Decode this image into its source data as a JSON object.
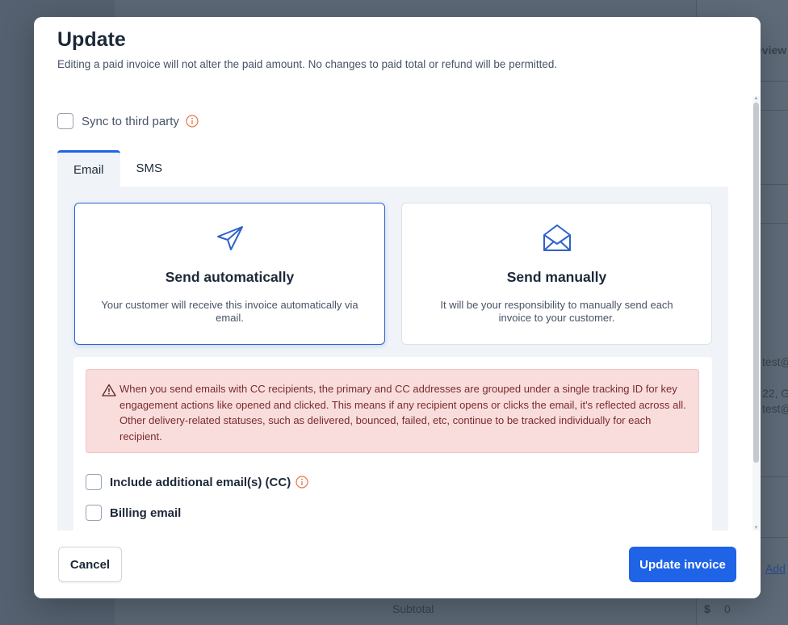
{
  "background": {
    "col_header": "eview",
    "email_partial_1": "test@",
    "address_partial": "22, G",
    "email_partial_2": "test@",
    "add_link": "Add",
    "subtotal_label": "Subtotal",
    "currency_symbol": "$",
    "subtotal_value": "0"
  },
  "modal": {
    "title": "Update",
    "subtitle": "Editing a paid invoice will not alter the paid amount. No changes to paid total or refund will be permitted.",
    "sync_label": "Sync to third party",
    "tabs": [
      {
        "label": "Email",
        "active": true
      },
      {
        "label": "SMS",
        "active": false
      }
    ],
    "cards": [
      {
        "title": "Send automatically",
        "description": "Your customer will receive this invoice automatically via email.",
        "icon": "paper-plane-icon",
        "selected": true
      },
      {
        "title": "Send manually",
        "description": "It will be your responsibility to manually send each invoice to your customer.",
        "icon": "envelope-open-icon",
        "selected": false
      }
    ],
    "alert_text": "When you send emails with CC recipients, the primary and CC addresses are grouped under a single tracking ID for key engagement actions like opened and clicked. This means if any recipient opens or clicks the email, it's reflected across all. Other delivery-related statuses, such as delivered, bounced, failed, etc, continue to be tracked individually for each recipient.",
    "include_cc_label": "Include additional email(s) (CC)",
    "billing_email_label": "Billing email",
    "cancel_label": "Cancel",
    "update_label": "Update invoice"
  },
  "colors": {
    "primary": "#1f63e6",
    "alert_bg": "#f9dddd",
    "alert_text": "#7a2b2b",
    "info_icon": "#e8734a"
  }
}
